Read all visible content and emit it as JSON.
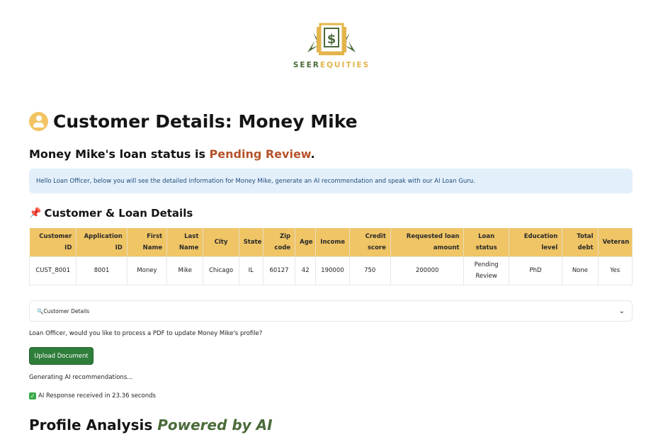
{
  "logo": {
    "text_a": "SEER",
    "text_b": "EQUITIES",
    "icon": "dollar-building-icon"
  },
  "header": {
    "title": "Customer Details: Money Mike",
    "icon": "person-circle-icon"
  },
  "status": {
    "prefix": "Money Mike's loan status is ",
    "value": "Pending Review",
    "suffix": ".",
    "value_color": "#b5532b"
  },
  "info_banner": "Hello Loan Officer, below you will see the detailed information for Money Mike, generate an AI recommendation and speak with our AI Loan Guru.",
  "section": {
    "icon": "pushpin-icon",
    "title": "Customer & Loan Details"
  },
  "table": {
    "headers": [
      [
        "Customer",
        "ID"
      ],
      [
        "Application",
        "ID"
      ],
      [
        "First",
        "Name"
      ],
      [
        "Last",
        "Name"
      ],
      [
        "City"
      ],
      [
        "State"
      ],
      [
        "Zip",
        "code"
      ],
      [
        "Age"
      ],
      [
        "Income"
      ],
      [
        "Credit",
        "score"
      ],
      [
        "Requested loan",
        "amount"
      ],
      [
        "Loan status"
      ],
      [
        "Education",
        "level"
      ],
      [
        "Total",
        "debt"
      ],
      [
        "Veteran"
      ]
    ],
    "row": [
      "CUST_8001",
      "8001",
      "Money",
      "Mike",
      "Chicago",
      "IL",
      "60127",
      "42",
      "190000",
      "750",
      "200000",
      "Pending Review",
      "PhD",
      "None",
      "Yes"
    ]
  },
  "expander": {
    "icon": "magnifier-icon",
    "label": "Customer Details"
  },
  "question": "Loan Officer, would you like to process a PDF to update Money Mike's profile?",
  "upload_button": "Upload Document",
  "generating": "Generating AI recommendations...",
  "response": "AI Response received in 23.36 seconds",
  "profile_analysis": {
    "title": "Profile Analysis ",
    "subtitle": "Powered by AI"
  },
  "colors": {
    "accent": "#f0c566",
    "brand_green": "#4a6b3a",
    "button_green": "#2f7d3a",
    "info_bg": "#e3effb"
  }
}
